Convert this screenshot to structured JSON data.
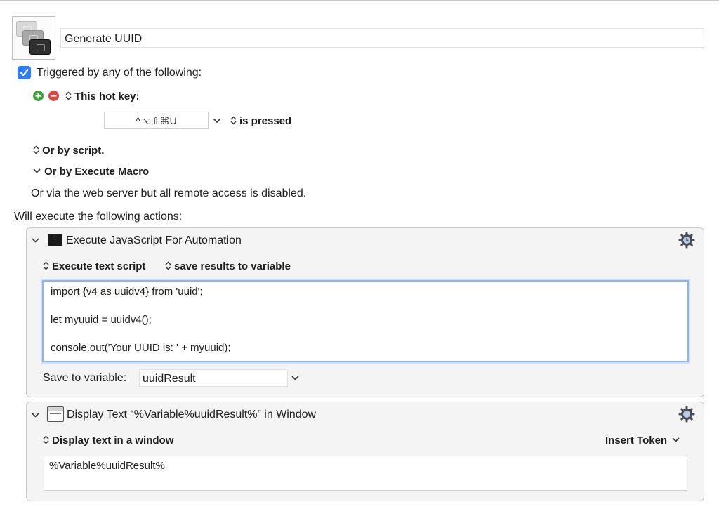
{
  "macro": {
    "name": "Generate UUID",
    "icon": "macro-windows-icon"
  },
  "trigger": {
    "enabled": true,
    "label": "Triggered by any of the following:",
    "hotkey_label": "This hot key:",
    "hotkey_value": "^⌥⇧⌘U",
    "pressed_label": "is pressed",
    "script_label": "Or by script.",
    "execute_macro_label": "Or by Execute Macro",
    "web_server_text": "Or via the web server but all remote access is disabled."
  },
  "actions_heading": "Will execute the following actions:",
  "actions": [
    {
      "title": "Execute JavaScript For Automation",
      "icon": "terminal-icon",
      "source_mode": "Execute text script",
      "output_mode": "save results to variable",
      "script_lines": [
        "import {v4 as uuidv4} from 'uuid';",
        "let myuuid = uuidv4();",
        "console.out('Your UUID is: ' + myuuid);"
      ],
      "save_to_label": "Save to variable:",
      "variable": "uuidResult"
    },
    {
      "title": "Display Text “%Variable%uuidResult%” in Window",
      "icon": "window-icon",
      "display_mode": "Display text in a window",
      "insert_token_label": "Insert Token",
      "text": "%Variable%uuidResult%"
    }
  ],
  "colors": {
    "checkbox": "#2f7df6",
    "add_button": "#3aa63a",
    "remove_button": "#e0443e",
    "focus_ring": "#8fb3f0"
  }
}
